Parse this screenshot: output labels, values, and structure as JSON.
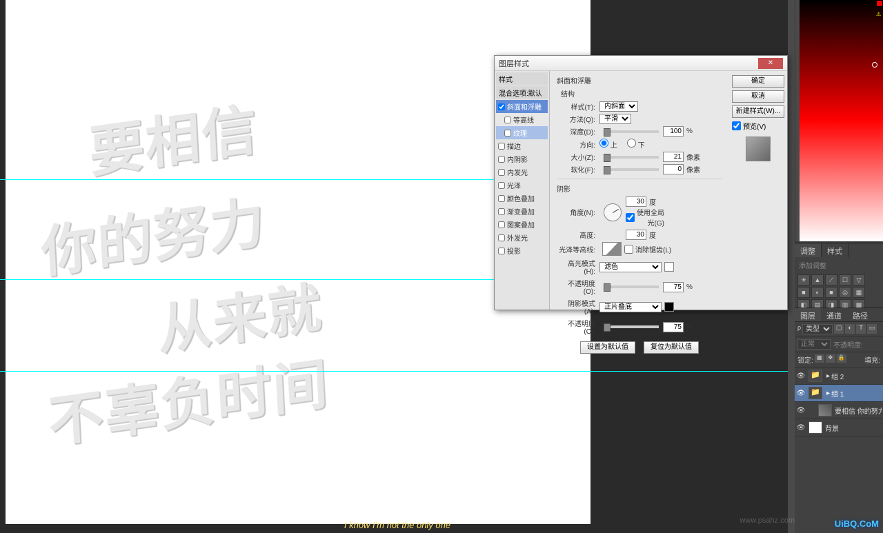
{
  "canvas": {
    "line1": "要相信",
    "line2": "你的努力",
    "line3": "从来就",
    "line4": "不辜负时间",
    "subtitle": "I know I'm not the only one"
  },
  "dialog": {
    "title": "图层样式",
    "left_header1": "样式",
    "left_header2": "混合选项:默认",
    "styles": [
      {
        "key": "bevel",
        "label": "斜面和浮雕",
        "checked": true,
        "active": true
      },
      {
        "key": "contour_sub",
        "label": "等高线",
        "checked": false,
        "sub": true
      },
      {
        "key": "texture_sub",
        "label": "纹理",
        "checked": false,
        "sub": true,
        "active_sub": true
      },
      {
        "key": "stroke",
        "label": "描边",
        "checked": false
      },
      {
        "key": "inner_shadow",
        "label": "内阴影",
        "checked": false
      },
      {
        "key": "inner_glow",
        "label": "内发光",
        "checked": false
      },
      {
        "key": "satin",
        "label": "光泽",
        "checked": false
      },
      {
        "key": "color_overlay",
        "label": "颜色叠加",
        "checked": false
      },
      {
        "key": "grad_overlay",
        "label": "渐变叠加",
        "checked": false
      },
      {
        "key": "pattern_overlay",
        "label": "图案叠加",
        "checked": false
      },
      {
        "key": "outer_glow",
        "label": "外发光",
        "checked": false
      },
      {
        "key": "drop_shadow",
        "label": "投影",
        "checked": false
      }
    ],
    "section_title": "斜面和浮雕",
    "struct_title": "结构",
    "style_label": "样式(T):",
    "style_value": "内斜面",
    "method_label": "方法(Q):",
    "method_value": "平滑",
    "depth_label": "深度(D):",
    "depth_value": "100",
    "depth_unit": "%",
    "dir_label": "方向:",
    "dir_up": "上",
    "dir_down": "下",
    "size_label": "大小(Z):",
    "size_value": "21",
    "size_unit": "像素",
    "soften_label": "软化(F):",
    "soften_value": "0",
    "soften_unit": "像素",
    "shadow_title": "阴影",
    "angle_label": "角度(N):",
    "angle_value": "30",
    "angle_unit": "度",
    "global_light": "使用全局光(G)",
    "altitude_label": "高度:",
    "altitude_value": "30",
    "altitude_unit": "度",
    "gloss_label": "光泽等高线:",
    "antialias": "消除锯齿(L)",
    "highlight_label": "高光模式(H):",
    "highlight_value": "滤色",
    "hl_opacity_label": "不透明度(O):",
    "hl_opacity_value": "75",
    "hl_opacity_unit": "%",
    "shadow_mode_label": "阴影模式(A):",
    "shadow_mode_value": "正片叠底",
    "sh_opacity_label": "不透明度(C):",
    "sh_opacity_value": "75",
    "sh_opacity_unit": "%",
    "btn_default": "设置为默认值",
    "btn_reset": "复位为默认值",
    "btn_ok": "确定",
    "btn_cancel": "取消",
    "btn_new": "新建样式(W)...",
    "preview_cb": "预览(V)"
  },
  "adjustments": {
    "tab1": "调整",
    "tab2": "样式",
    "sub": "添加调整"
  },
  "layers": {
    "tab1": "图层",
    "tab2": "通道",
    "tab3": "路径",
    "filter_label": "类型",
    "blend_mode": "正常",
    "opacity_label": "不透明度:",
    "lock_label": "锁定:",
    "fill_label": "填充:",
    "items": [
      {
        "name": "组 2",
        "type": "folder",
        "visible": true,
        "indent": 0
      },
      {
        "name": "组 1",
        "type": "folder",
        "visible": true,
        "indent": 0,
        "selected": true
      },
      {
        "name": "要相信 你的努力 从未",
        "type": "text",
        "visible": true,
        "indent": 1,
        "fx": true
      },
      {
        "name": "背景",
        "type": "bg",
        "visible": true,
        "indent": 0
      }
    ]
  },
  "watermark": "UiBQ.CoM",
  "watermark2": "www.psahz.com"
}
